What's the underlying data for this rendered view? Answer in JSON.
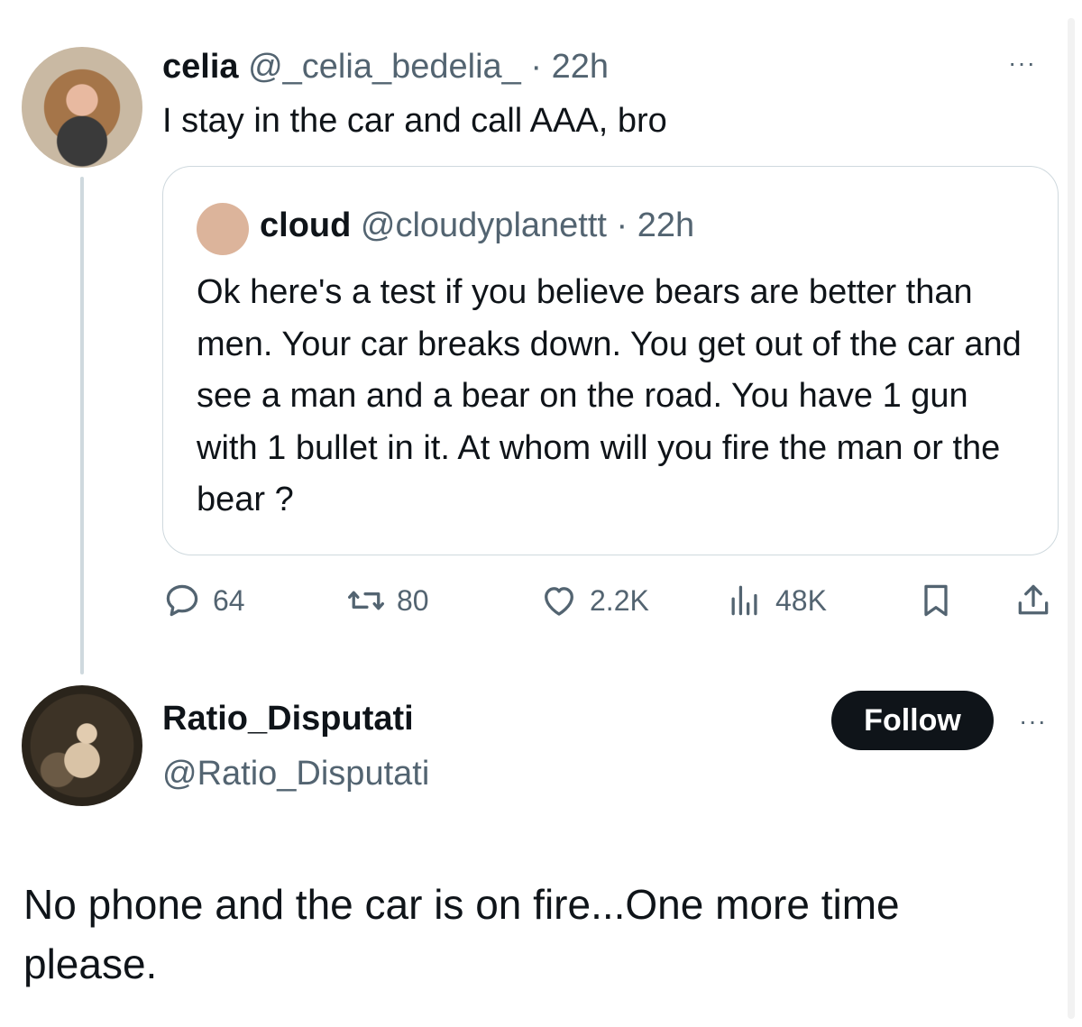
{
  "main_tweet": {
    "name": "celia",
    "handle": "@_celia_bedelia_",
    "separator": " · ",
    "time": "22h",
    "text": "I stay in the car and call AAA, bro",
    "more_label": "···"
  },
  "quoted_tweet": {
    "name": "cloud",
    "handle": "@cloudyplanettt",
    "separator": " · ",
    "time": "22h",
    "text": "Ok here's a test if you believe bears are better than men. Your car breaks down. You get out of the car and see a man and a bear on the road. You have 1 gun with 1 bullet in it. At whom will you fire the man or the bear ?"
  },
  "actions": {
    "replies": "64",
    "reposts": "80",
    "likes": "2.2K",
    "views": "48K"
  },
  "reply_tweet": {
    "name": "Ratio_Disputati",
    "handle": "@Ratio_Disputati",
    "follow_label": "Follow",
    "more_label": "···",
    "text": "No phone and the car is on fire...One more time please."
  },
  "icons": {
    "reply": "speech-bubble-icon",
    "repost": "repost-arrows-icon",
    "like": "heart-icon",
    "views": "bar-chart-icon",
    "bookmark": "bookmark-icon",
    "share": "share-upload-icon",
    "more": "ellipsis-icon"
  },
  "colors": {
    "text": "#0f1419",
    "secondary": "#536471",
    "border": "#cfd9de",
    "follow_bg": "#0f1419"
  }
}
